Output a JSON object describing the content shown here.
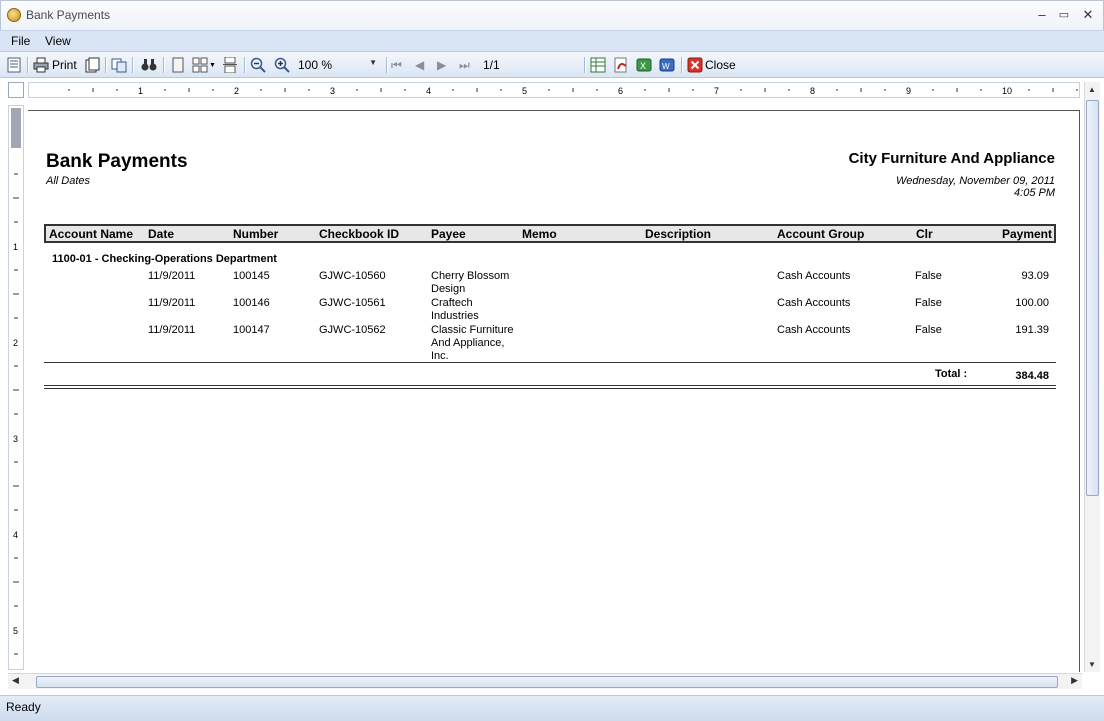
{
  "window": {
    "title": "Bank Payments",
    "minimize": "–",
    "maximize": "▭",
    "close": "✕"
  },
  "menu": [
    {
      "label": "File"
    },
    {
      "label": "View"
    }
  ],
  "toolbar": {
    "print_label": "Print",
    "zoom_value": "100 %",
    "page_value": "1/1",
    "close_label": "Close"
  },
  "ruler": {
    "h_labels": [
      "1",
      "2",
      "3",
      "4",
      "5",
      "6",
      "7",
      "8",
      "9",
      "10"
    ],
    "v_labels": [
      "1",
      "2",
      "3",
      "4",
      "5"
    ]
  },
  "report": {
    "title": "Bank Payments",
    "subtitle": "All Dates",
    "company": "City Furniture And Appliance",
    "date_line": "Wednesday, November 09, 2011",
    "time_line": "4:05 PM",
    "columns": [
      "Account Name",
      "Date",
      "Number",
      "Checkbook ID",
      "Payee",
      "Memo",
      "Description",
      "Account Group",
      "Clr",
      "Payment"
    ],
    "group_label": "1100-01 - Checking-Operations Department",
    "rows": [
      {
        "date": "11/9/2011",
        "number": "100145",
        "checkbook": "GJWC-10560",
        "payee": "Cherry Blossom\nDesign",
        "group": "Cash Accounts",
        "clr": "False",
        "payment": "93.09"
      },
      {
        "date": "11/9/2011",
        "number": "100146",
        "checkbook": "GJWC-10561",
        "payee": "Craftech\nIndustries",
        "group": "Cash Accounts",
        "clr": "False",
        "payment": "100.00"
      },
      {
        "date": "11/9/2011",
        "number": "100147",
        "checkbook": "GJWC-10562",
        "payee": "Classic Furniture\nAnd Appliance,\nInc.",
        "group": "Cash Accounts",
        "clr": "False",
        "payment": "191.39"
      }
    ],
    "total_label": "Total :",
    "total_value": "384.48"
  },
  "status": {
    "text": "Ready"
  }
}
